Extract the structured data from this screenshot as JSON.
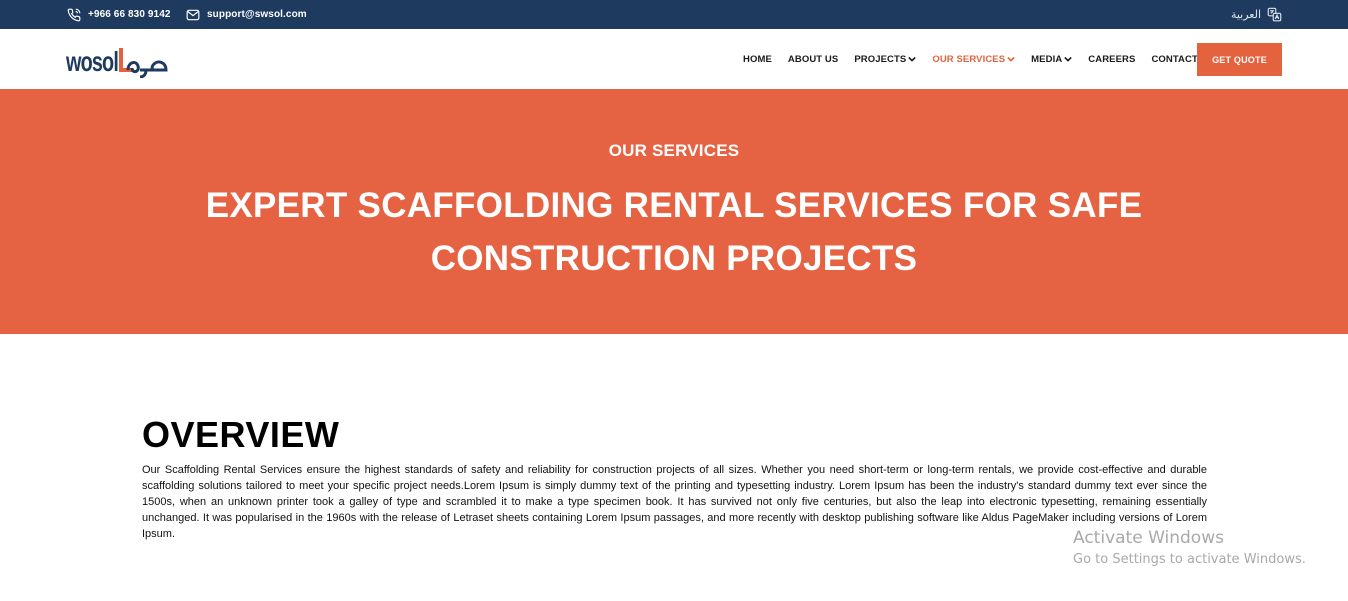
{
  "topbar": {
    "phone": "+966 66 830 9142",
    "email": "support@swsol.com",
    "language": "العربية"
  },
  "header": {
    "logo_text": "wosol",
    "nav": {
      "home": "HOME",
      "about": "ABOUT US",
      "projects": "PROJECTS",
      "services": "OUR SERVICES",
      "media": "MEDIA",
      "careers": "CAREERS",
      "contact": "CONTACT US"
    },
    "quote_button": "GET QUOTE"
  },
  "colors": {
    "topbar": "#1e3a5f",
    "accent": "#e5623f"
  },
  "hero": {
    "eyebrow": "OUR SERVICES",
    "title": "EXPERT SCAFFOLDING RENTAL SERVICES FOR SAFE CONSTRUCTION PROJECTS"
  },
  "overview": {
    "title": "OVERVIEW",
    "text": "Our Scaffolding Rental Services ensure the highest standards of safety and reliability for construction projects of all sizes. Whether you need short-term or long-term rentals, we provide cost-effective and durable scaffolding solutions tailored to meet your specific project needs.Lorem Ipsum is simply dummy text of the printing and typesetting industry. Lorem Ipsum has been the industry's standard dummy text ever since the 1500s, when an unknown printer took a galley of type and scrambled it to make a type specimen book. It has survived not only five centuries, but also the leap into electronic typesetting, remaining essentially unchanged. It was popularised in the 1960s with the release of Letraset sheets containing Lorem Ipsum passages, and more recently with desktop publishing software like Aldus PageMaker including versions of Lorem Ipsum."
  },
  "watermark": {
    "line1": "Activate Windows",
    "line2": "Go to Settings to activate Windows."
  }
}
